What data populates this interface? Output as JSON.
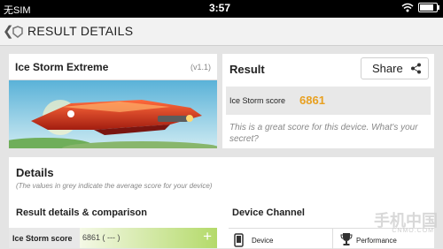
{
  "status_bar": {
    "carrier": "无SIM",
    "time": "3:57"
  },
  "app_bar": {
    "title": "RESULT DETAILS"
  },
  "test_card": {
    "name": "Ice Storm Extreme",
    "version": "(v1.1)"
  },
  "result_card": {
    "title": "Result",
    "share_label": "Share",
    "score_label": "Ice Storm score",
    "score_value": "6861",
    "message": "This is a great score for this device. What's your secret?"
  },
  "details": {
    "title": "Details",
    "subtitle": "(The values in grey indicate the average score for your device)",
    "comparison_header": "Result details & comparison",
    "channel_header": "Device Channel",
    "row_label": "Ice Storm score",
    "row_value": "6861 ( --- )",
    "device_label": "Device",
    "performance_label": "Performance"
  },
  "watermark": {
    "text": "手机中国",
    "sub": "CNMO.COM"
  },
  "colors": {
    "score_accent": "#e8a020",
    "bar_green": "#b4da6a"
  },
  "icons": [
    "back-chevron-icon",
    "wifi-icon",
    "battery-icon",
    "share-icon",
    "plus-icon",
    "phone-icon",
    "trophy-icon"
  ]
}
